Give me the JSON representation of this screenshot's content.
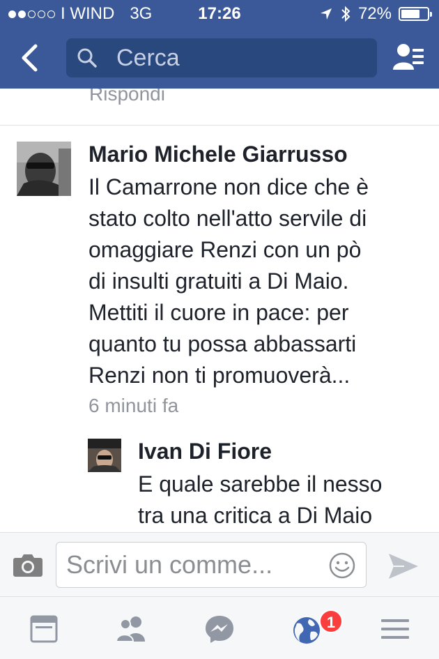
{
  "status_bar": {
    "carrier": "I WIND",
    "network": "3G",
    "time": "17:26",
    "battery": "72%",
    "battery_level": 0.72,
    "signal_bars_filled": 2,
    "signal_bars_total": 5
  },
  "nav": {
    "back_icon": "chevron-left-icon",
    "search_placeholder": "Cerca",
    "friends_icon": "friend-requests-icon",
    "bar_color": "#3b5998"
  },
  "feed": {
    "prev_reply_label": "Rispondi",
    "comments": [
      {
        "author": "Mario Michele Giarrusso",
        "lines": [
          "Il Camarrone non dice che è",
          "stato colto nell'atto servile di",
          "omaggiare Renzi con un pò",
          "di insulti gratuiti a Di Maio.",
          "Mettiti il cuore in pace: per",
          "quanto tu possa abbassarti",
          "Renzi non ti promuoverà..."
        ],
        "time": "6 minuti fa"
      },
      {
        "author": "Ivan Di Fiore",
        "lines": [
          "E quale sarebbe il nesso",
          "tra una critica a Di Maio"
        ]
      }
    ]
  },
  "composer": {
    "placeholder": "Scrivi un comme...",
    "camera_icon": "camera-icon",
    "emoji_icon": "smiley-icon",
    "send_icon": "send-icon"
  },
  "tabbar": {
    "tabs": [
      "news-feed-icon",
      "friends-icon",
      "messenger-icon",
      "notifications-globe-icon",
      "menu-icon"
    ],
    "notifications_badge": "1",
    "badge_color": "#fa3e3e"
  }
}
